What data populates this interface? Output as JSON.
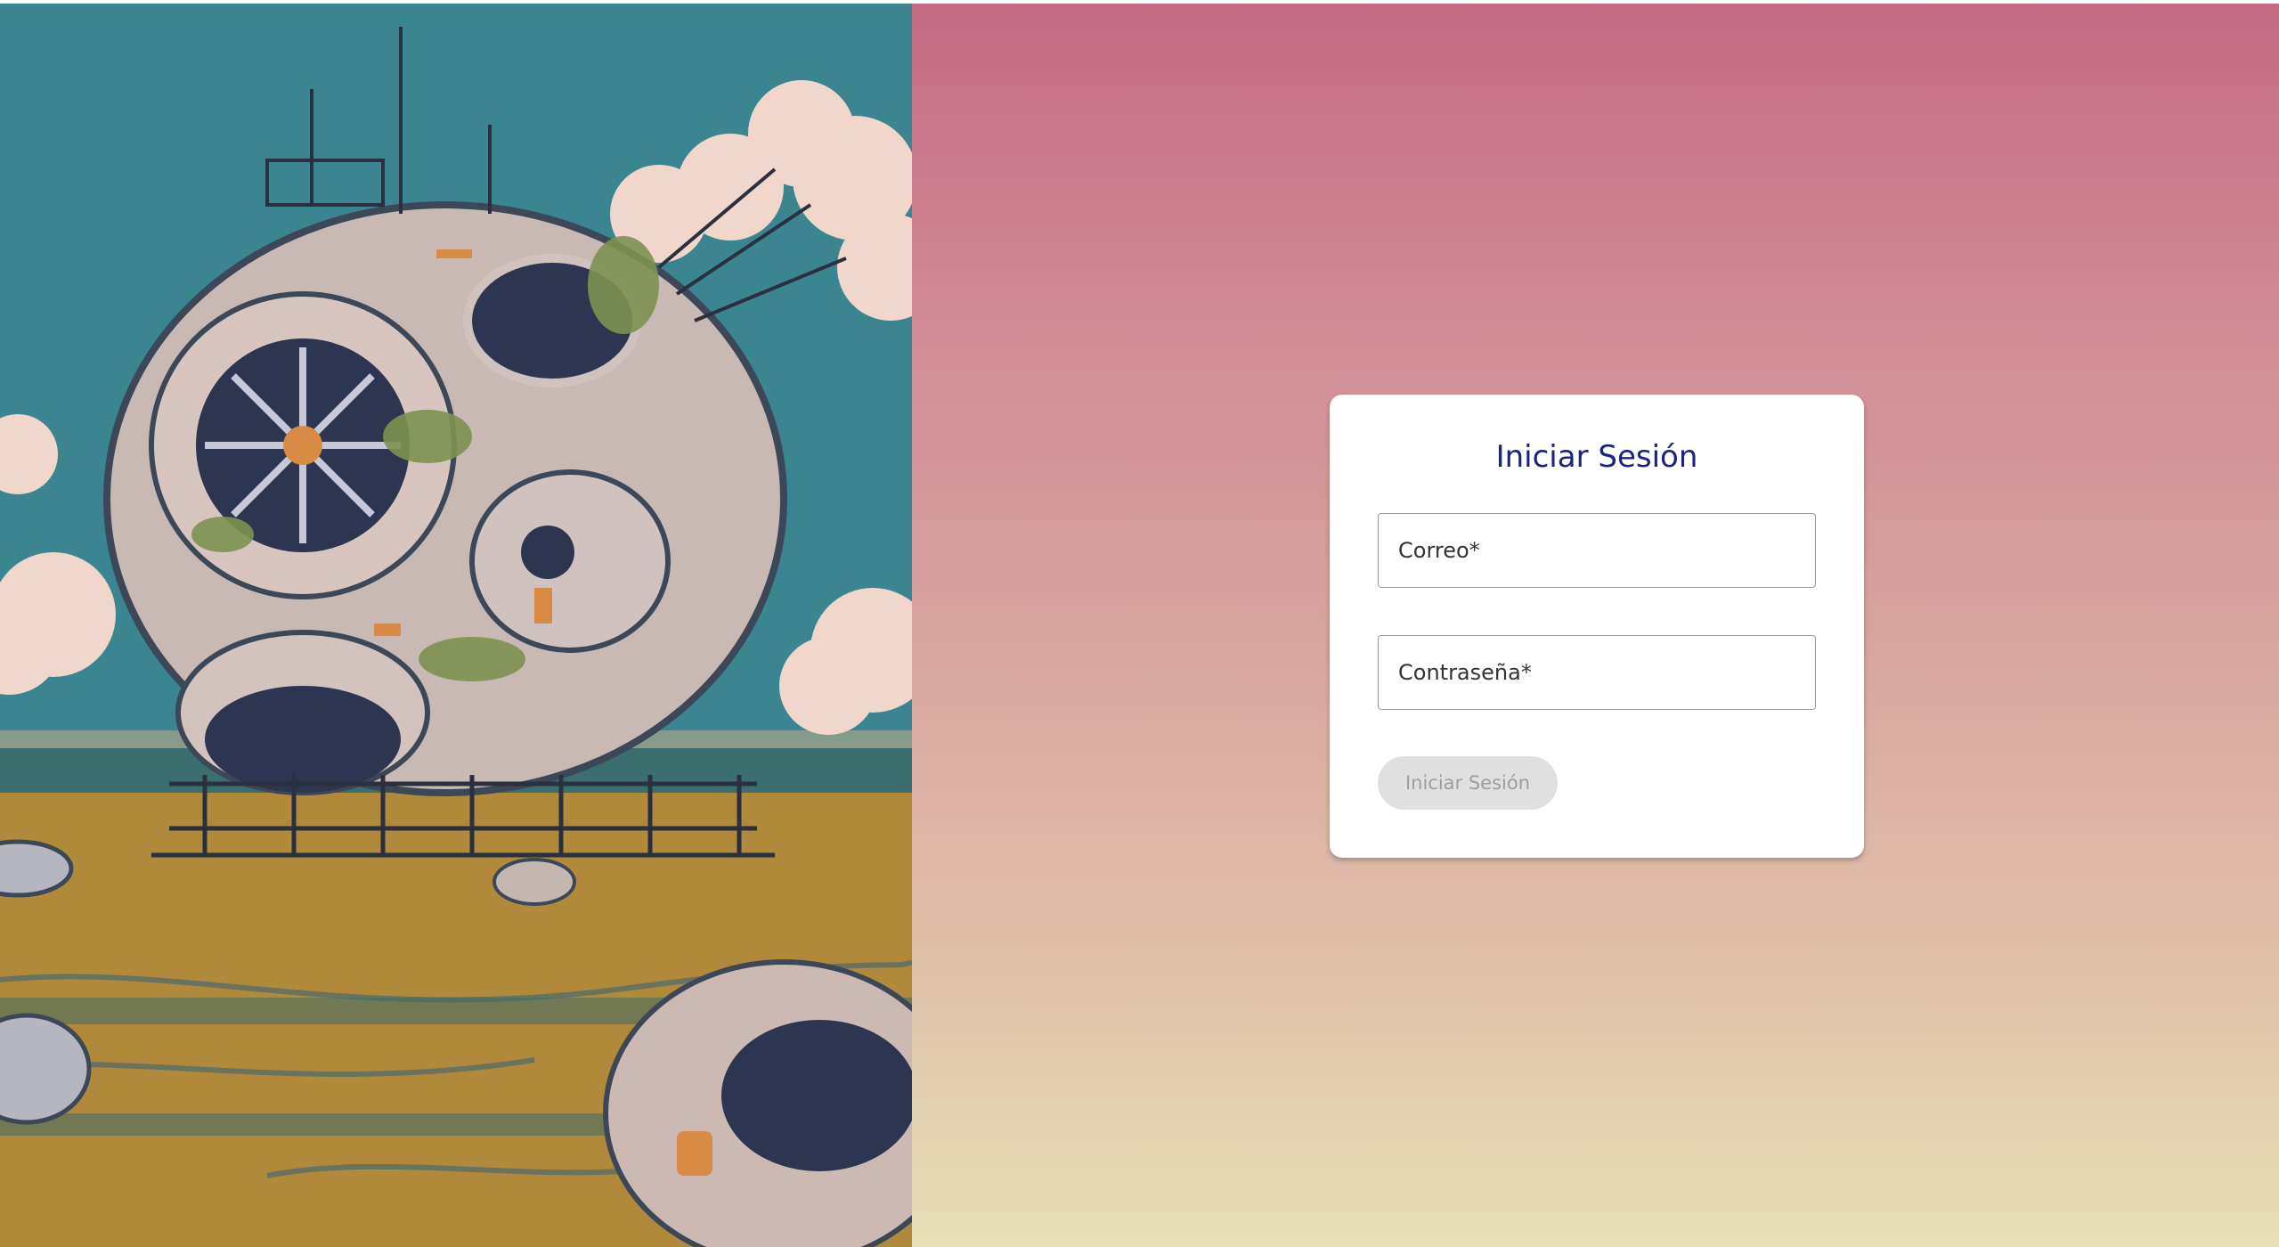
{
  "login": {
    "title": "Iniciar Sesión",
    "email_label": "Correo*",
    "password_label": "Contraseña*",
    "submit_label": "Iniciar Sesión"
  },
  "colors": {
    "title": "#1a237e",
    "button_disabled_bg": "#e0e0e0",
    "button_disabled_text": "#9e9e9e",
    "gradient_top": "#c46a84",
    "gradient_bottom": "#e6dfb6"
  },
  "hero_image": {
    "subject": "illustration of an overgrown derelict spherical machine in a marsh under a crescent moon"
  }
}
